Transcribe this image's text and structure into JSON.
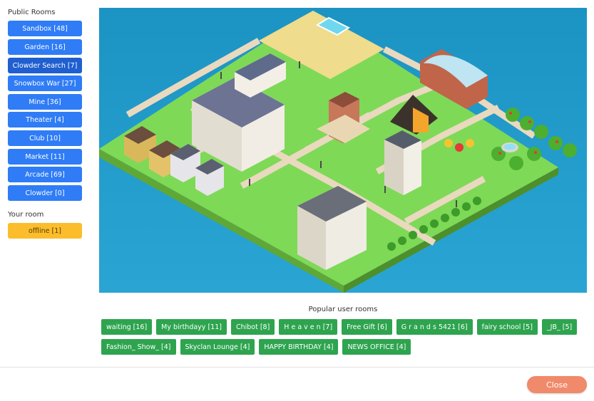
{
  "sidebar": {
    "public_title": "Public Rooms",
    "rooms": [
      {
        "label": "Sandbox [48]"
      },
      {
        "label": "Garden [16]"
      },
      {
        "label": "Clowder Search [7]"
      },
      {
        "label": "Snowbox War [27]"
      },
      {
        "label": "Mine [36]"
      },
      {
        "label": "Theater [4]"
      },
      {
        "label": "Club [10]"
      },
      {
        "label": "Market [11]"
      },
      {
        "label": "Arcade [69]"
      },
      {
        "label": "Clowder [0]"
      }
    ],
    "your_title": "Your room",
    "own_room": {
      "label": "offline [1]"
    }
  },
  "popular": {
    "title": "Popular user rooms",
    "rooms": [
      {
        "label": "waiting [16]"
      },
      {
        "label": "My birthdayy [11]"
      },
      {
        "label": "Chibot [8]"
      },
      {
        "label": "H e a v e n [7]"
      },
      {
        "label": "Free Gift [6]"
      },
      {
        "label": "G r a n d s 5421 [6]"
      },
      {
        "label": "fairy school [5]"
      },
      {
        "label": "_JB_ [5]"
      },
      {
        "label": "Fashion_ Show_ [4]"
      },
      {
        "label": "Skyclan Lounge [4]"
      },
      {
        "label": "HAPPY BIRTHDAY [4]"
      },
      {
        "label": "NEWS OFFICE [4]"
      }
    ]
  },
  "footer": {
    "close_label": "Close"
  },
  "colors": {
    "public_button": "#2f7cf6",
    "selected_button": "#1f5fcf",
    "own_room_button": "#fbbd2c",
    "popular_chip": "#2ea44f",
    "close_button": "#f08a6a",
    "water": "#1e98c8",
    "grass": "#7ed957"
  }
}
